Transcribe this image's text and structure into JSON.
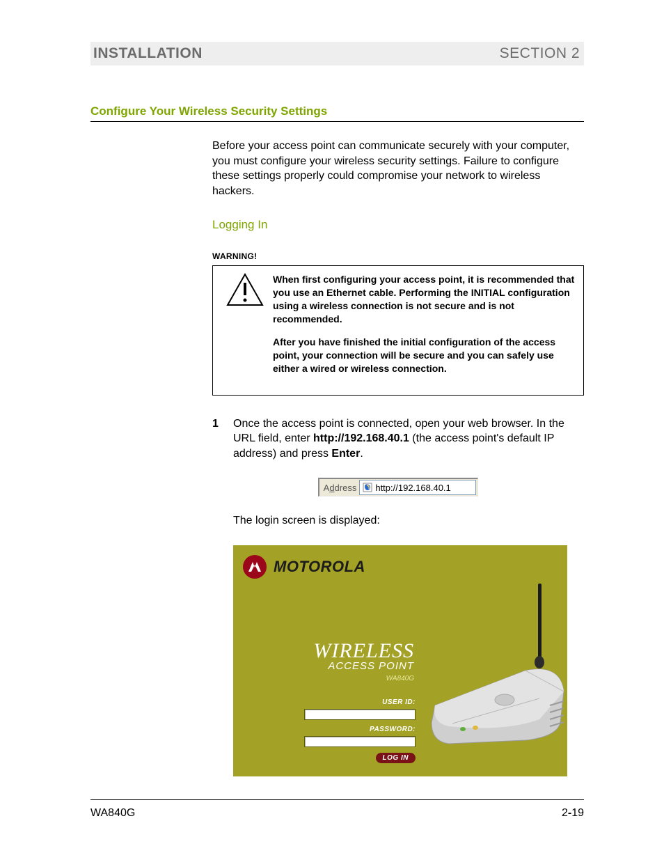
{
  "header": {
    "left": "INSTALLATION",
    "right": "SECTION 2"
  },
  "section_title": "Configure Your Wireless Security Settings",
  "intro_paragraph": "Before your access point can communicate securely with your computer, you must configure your wireless security settings. Failure to configure these settings properly could compromise your network to wireless hackers.",
  "sub_title": "Logging In",
  "warning_label": "WARNING!",
  "warning": {
    "p1": "When first configuring your access point, it is recommended that you use an Ethernet cable. Performing the INITIAL configuration using a wireless connection is not secure and is not recommended.",
    "p2": "After you have finished the initial configuration of the access point, your connection will be secure and you can safely use either a wired or wireless connection."
  },
  "step1": {
    "num": "1",
    "pre": "Once the access point is connected, open your web browser. In the URL field, enter ",
    "url": "http://192.168.40.1",
    "mid": " (the access point's default IP address) and press ",
    "enter": "Enter",
    "post": "."
  },
  "address_bar": {
    "label_pre": "A",
    "label_u": "d",
    "label_post": "dress",
    "value": "http://192.168.40.1"
  },
  "after_step": "The login screen is displayed:",
  "login": {
    "brand": "MOTOROLA",
    "wireless": "WIRELESS",
    "access_point": "ACCESS POINT",
    "model": "WA840G",
    "userid_label": "USER ID:",
    "password_label": "PASSWORD:",
    "login_button": "LOG IN"
  },
  "footer": {
    "left": "WA840G",
    "right_pre": "2",
    "right_dash": "-",
    "right_post": "19"
  }
}
